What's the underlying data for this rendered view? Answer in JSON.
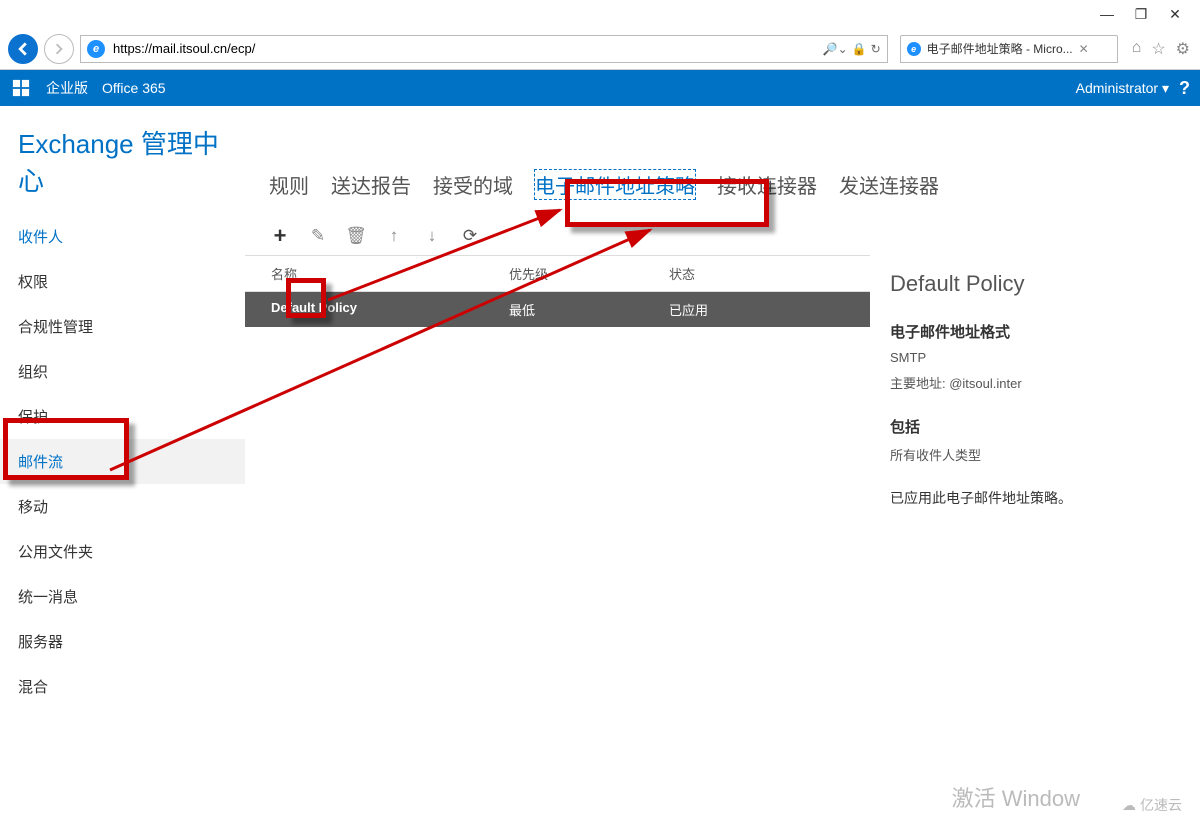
{
  "os": {
    "minimize": "—",
    "maximize": "❐",
    "close": "✕"
  },
  "browser": {
    "url": "https://mail.itsoul.cn/ecp/",
    "url_tools": {
      "search": "⌄",
      "lock": "🔒",
      "refresh": "↻"
    },
    "tab_title": "电子邮件地址策略 - Micro...",
    "right_icons": {
      "home": "⌂",
      "star": "☆",
      "gear": "⚙"
    }
  },
  "o365": {
    "edition": "企业版",
    "product": "Office 365",
    "user": "Administrator",
    "caret": "▾",
    "help": "?"
  },
  "page_title": "Exchange 管理中心",
  "nav": {
    "items": [
      {
        "label": "收件人"
      },
      {
        "label": "权限"
      },
      {
        "label": "合规性管理"
      },
      {
        "label": "组织"
      },
      {
        "label": "保护"
      },
      {
        "label": "邮件流"
      },
      {
        "label": "移动"
      },
      {
        "label": "公用文件夹"
      },
      {
        "label": "统一消息"
      },
      {
        "label": "服务器"
      },
      {
        "label": "混合"
      }
    ]
  },
  "tabs": {
    "items": [
      {
        "label": "规则"
      },
      {
        "label": "送达报告"
      },
      {
        "label": "接受的域"
      },
      {
        "label": "电子邮件地址策略"
      },
      {
        "label": "接收连接器"
      },
      {
        "label": "发送连接器"
      }
    ]
  },
  "toolbar": {
    "add": "+",
    "edit": "✎",
    "delete": "🗑",
    "up": "↑",
    "down": "↓",
    "refresh": "⟳"
  },
  "table": {
    "headers": {
      "name": "名称",
      "priority": "优先级",
      "status": "状态"
    },
    "rows": [
      {
        "name": "Default Policy",
        "priority": "最低",
        "status": "已应用"
      }
    ]
  },
  "detail": {
    "title": "Default Policy",
    "section1_title": "电子邮件地址格式",
    "smtp": "SMTP",
    "primary": "主要地址: @itsoul.inter",
    "section2_title": "包括",
    "include": "所有收件人类型",
    "applied": "已应用此电子邮件地址策略。"
  },
  "watermark": "亿速云",
  "activate": "激活 Window"
}
